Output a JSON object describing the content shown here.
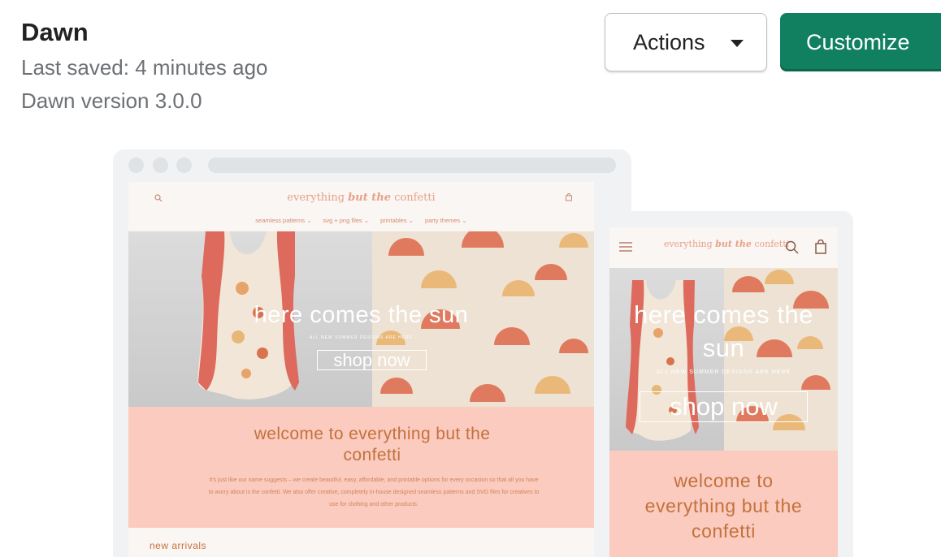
{
  "theme": {
    "name": "Dawn",
    "last_saved": "Last saved: 4 minutes ago",
    "version": "Dawn version 3.0.0"
  },
  "toolbar": {
    "actions_label": "Actions",
    "customize_label": "Customize"
  },
  "colors": {
    "customize_bg": "#108060",
    "welcome_bg": "#facbbe",
    "accent_text": "#c4713d"
  },
  "icons": [
    "search-icon",
    "cart-icon",
    "menu-icon",
    "caret-down-icon"
  ],
  "preview": {
    "logo_prefix": "everything",
    "logo_mid": "but the",
    "logo_suffix": "confetti",
    "nav": [
      "seamless patterns ⌄",
      "svg + png files ⌄",
      "printables ⌄",
      "party themes ⌄"
    ],
    "hero_title": "here comes the sun",
    "hero_subtitle": "ALL NEW SUMMER DESIGNS ARE HERE",
    "hero_button": "shop now",
    "welcome_title": "welcome to everything but the confetti",
    "welcome_body": "It's just like our name suggests – we create beautiful, easy, affordable, and printable options for every occasion so that all you have to worry about is the confetti. We also offer creative, completely in-house designed seamless patterns and SVG files for creatives to use for clothing and other products.",
    "new_arrivals": "new arrivals"
  }
}
